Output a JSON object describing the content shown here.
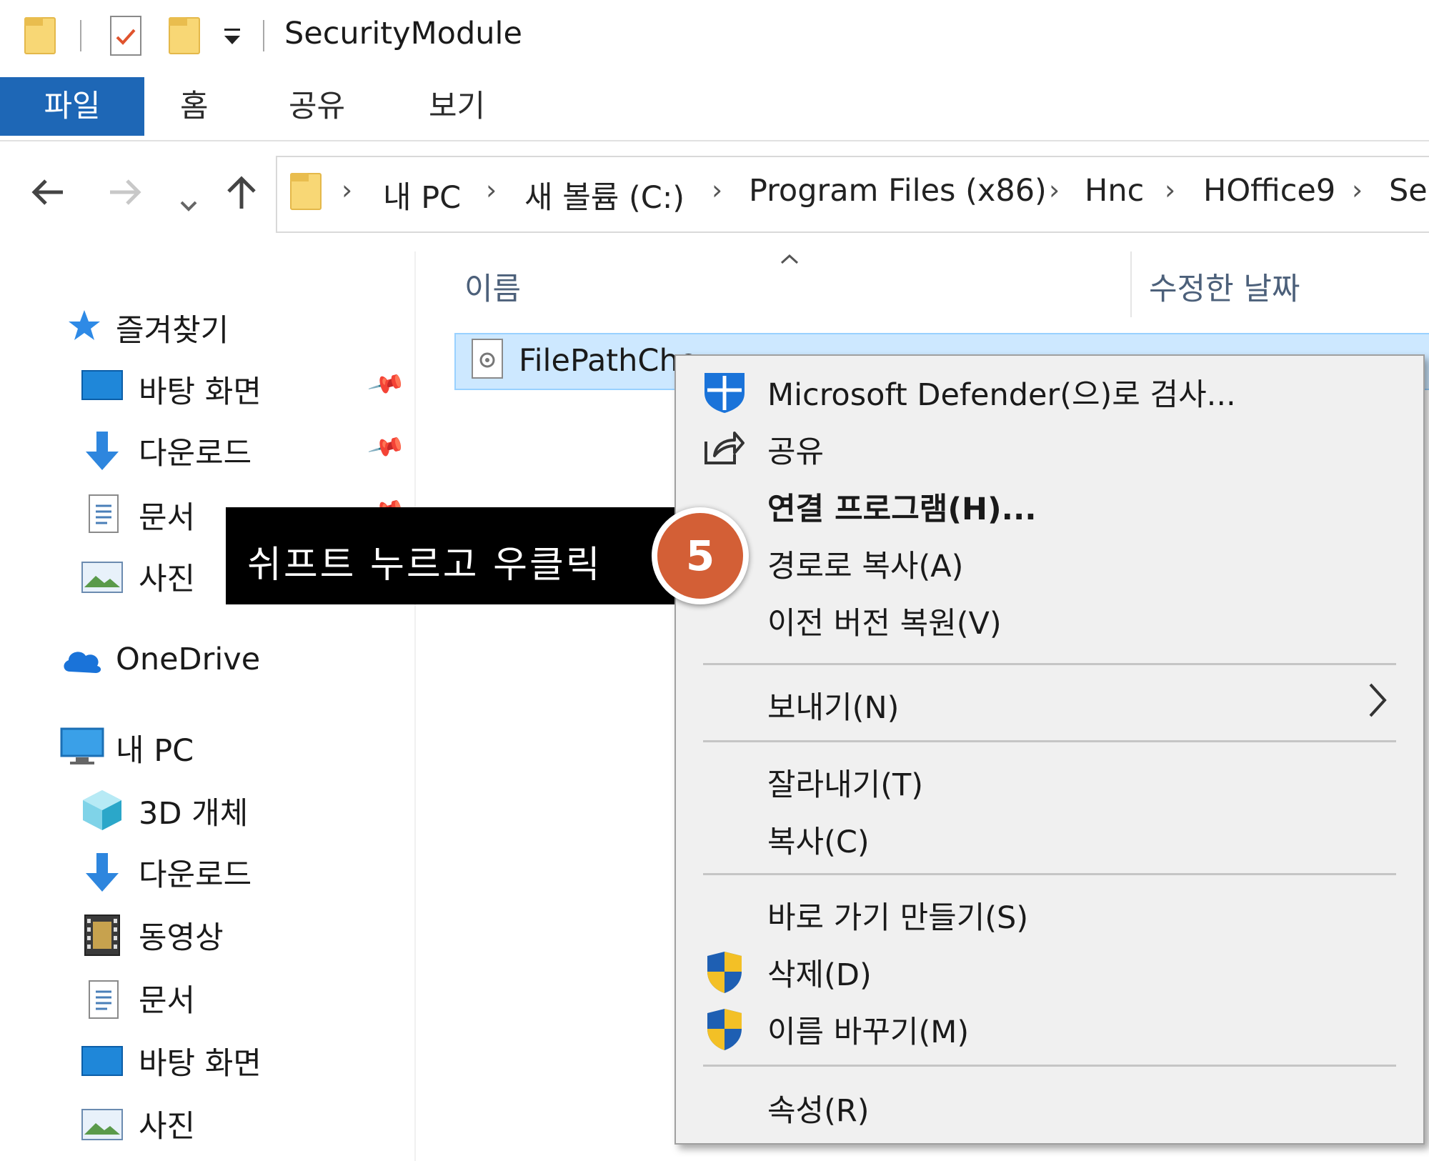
{
  "window": {
    "title": "SecurityModule"
  },
  "ribbon": {
    "tabs": [
      "파일",
      "홈",
      "공유",
      "보기"
    ]
  },
  "address": {
    "crumbs": [
      "내 PC",
      "새 볼륨 (C:)",
      "Program Files (x86)",
      "Hnc",
      "HOffice9",
      "Sec"
    ]
  },
  "columns": {
    "name": "이름",
    "date": "수정한 날짜"
  },
  "sidebar": {
    "favorites": "즐겨찾기",
    "quick": [
      "바탕 화면",
      "다운로드",
      "문서",
      "사진"
    ],
    "onedrive": "OneDrive",
    "thispc": "내 PC",
    "pc_items": [
      "3D 개체",
      "다운로드",
      "동영상",
      "문서",
      "바탕 화면",
      "사진"
    ]
  },
  "file": {
    "name": "FilePathChe"
  },
  "tooltip": {
    "text": "쉬프트 누르고 우클릭",
    "step": "5"
  },
  "context_menu": {
    "items": [
      "Microsoft Defender(으)로 검사...",
      "공유",
      "연결 프로그램(H)...",
      "경로로 복사(A)",
      "이전 버전 복원(V)",
      "보내기(N)",
      "잘라내기(T)",
      "복사(C)",
      "바로 가기 만들기(S)",
      "삭제(D)",
      "이름 바꾸기(M)",
      "속성(R)"
    ]
  },
  "colors": {
    "ribbon_file_bg": "#1e67b6",
    "selection_bg": "#cde8ff",
    "badge": "#d35f36"
  }
}
